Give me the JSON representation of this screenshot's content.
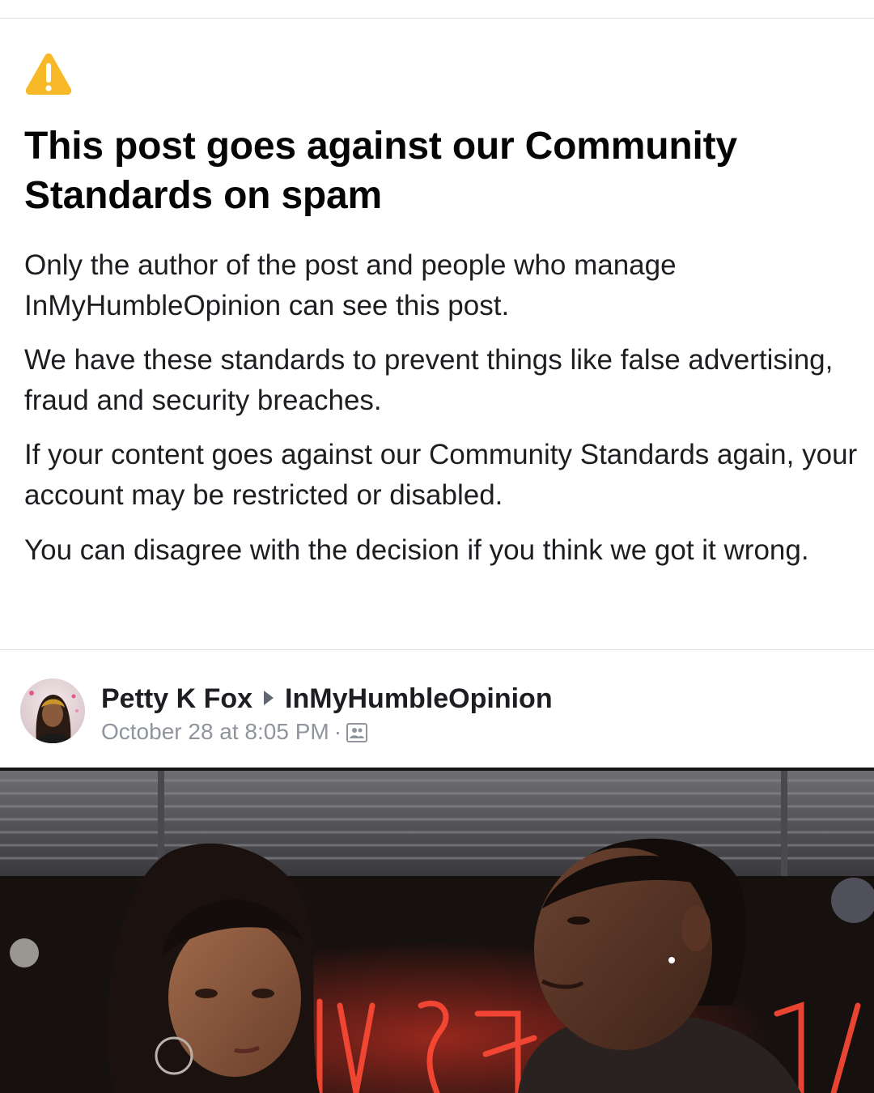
{
  "notice": {
    "title": "This post goes against our Community Standards on spam",
    "paragraphs": [
      "Only the author of the post and people who manage InMyHumbleOpinion can see this post.",
      "We have these standards to prevent things like false advertising, fraud and security breaches.",
      "If your content goes against our Community Standards again, your account may be restricted or disabled.",
      "You can disagree with the decision if you think we got it wrong."
    ],
    "icon": "warning-icon",
    "accent": "#F7B928"
  },
  "post": {
    "author": "Petty K Fox",
    "group": "InMyHumbleOpinion",
    "timestamp": "October 28 at 8:05 PM",
    "separator": "·",
    "audience_icon": "group-members-icon"
  },
  "photo": {
    "description_icon": "video-still-image"
  }
}
